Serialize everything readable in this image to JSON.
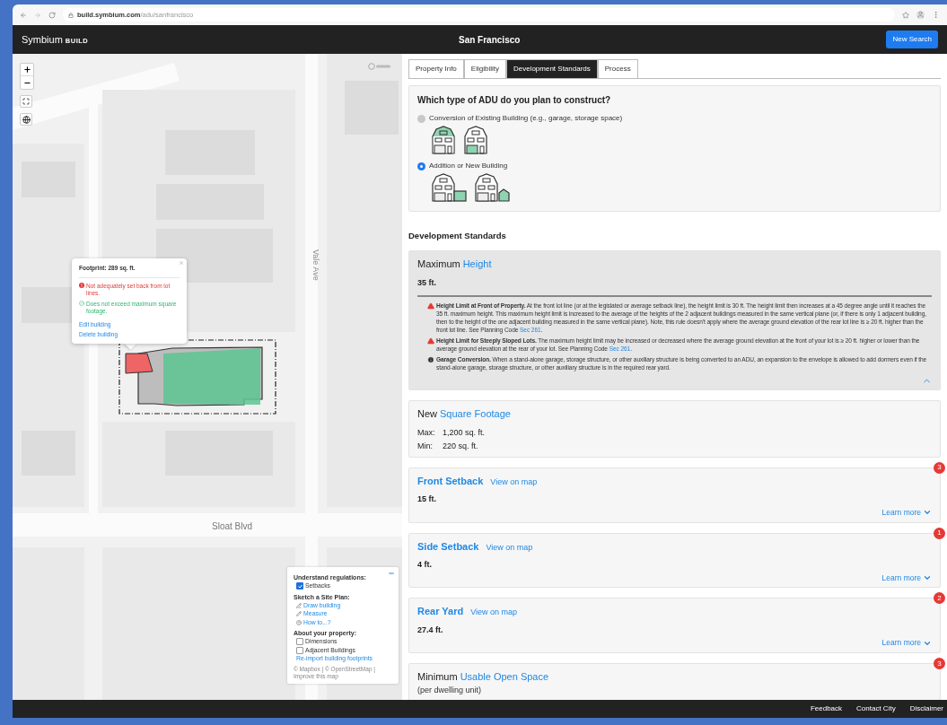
{
  "browser": {
    "host": "build.symbium.com",
    "path": "/adu/sanfrancisco"
  },
  "header": {
    "logo": "Symbium",
    "logo_suffix": "BUILD",
    "city": "San Francisco",
    "button": "New Search"
  },
  "map": {
    "streets": [
      {
        "name": "Vale Ave",
        "kind": "vertical"
      },
      {
        "name": "Sloat Blvd",
        "kind": "horizontal"
      }
    ],
    "popup": {
      "title": "Footprint: 289 sq. ft.",
      "checks": [
        {
          "kind": "fail",
          "text": "Not adequately set back from lot lines."
        },
        {
          "kind": "pass",
          "text": "Does not exceed maximum square footage."
        }
      ],
      "links": [
        "Edit building",
        "Delete building"
      ]
    },
    "legend": {
      "sections": [
        {
          "title": "Understand regulations:",
          "items": [
            {
              "kind": "checkbox",
              "label": "Setbacks",
              "checked": true
            }
          ]
        },
        {
          "title": "Sketch a Site Plan:",
          "items": [
            {
              "kind": "tool",
              "label": "Draw building"
            },
            {
              "kind": "tool",
              "label": "Measure"
            },
            {
              "kind": "help",
              "label": "How to...?"
            }
          ]
        },
        {
          "title": "About your property:",
          "items": [
            {
              "kind": "checkbox",
              "label": "Dimensions",
              "checked": false
            },
            {
              "kind": "checkbox",
              "label": "Adjacent Buildings",
              "checked": false
            },
            {
              "kind": "link",
              "label": "Re-import building footprints"
            }
          ]
        }
      ],
      "attribution": "© Mapbox | © OpenStreetMap | Improve this map"
    }
  },
  "tabs": [
    {
      "label": "Property Info",
      "selected": false
    },
    {
      "label": "Eligibility",
      "selected": false
    },
    {
      "label": "Development Standards",
      "selected": true
    },
    {
      "label": "Process",
      "selected": false
    }
  ],
  "adu": {
    "question": "Which type of ADU do you plan to construct?",
    "options": [
      {
        "label": "Conversion of Existing Building (e.g., garage, storage space)",
        "selected": false
      },
      {
        "label": "Addition or New Building",
        "selected": true
      }
    ]
  },
  "section_title": "Development Standards",
  "cards": [
    {
      "kind": "standard",
      "prefix": "Maximum",
      "title": "Height",
      "value": "35 ft.",
      "expanded": true,
      "notes": [
        {
          "kind": "warning",
          "title": "Height Limit at Front of Property.",
          "text": "At the front lot line (or at the legislated or average setback line), the height limit is 30 ft. The height limit then increases at a 45 degree angle until it reaches the 35 ft. maximum height. This maximum height limit is increased to the average of the heights of the 2 adjacent buildings measured in the same vertical plane (or, if there is only 1 adjacent building, then to the height of the one adjacent building measured in the same vertical plane). Note, this rule doesn't apply where the average ground elevation of the rear lot line is ≥ 20 ft. higher than the front lot line. See Planning Code",
          "link": "Sec 261",
          "tail": "."
        },
        {
          "kind": "warning",
          "title": "Height Limit for Steeply Sloped Lots.",
          "text": "The maximum height limit may be increased or decreased where the average ground elevation at the front of your lot is ≥ 20 ft. higher or lower than the average ground elevation at the rear of your lot. See Planning Code",
          "link": "Sec 261",
          "tail": "."
        },
        {
          "kind": "info",
          "title": "Garage Conversion.",
          "text": "When a stand-alone garage, storage structure, or other auxiliary structure is being converted to an ADU, an expansion to the envelope is allowed to add dormers even if the stand-alone garage, storage structure, or other auxiliary structure is in the required rear yard."
        }
      ]
    },
    {
      "kind": "standard",
      "prefix": "New",
      "title": "Square Footage",
      "rows": [
        {
          "label": "Max:",
          "value": "1,200 sq. ft."
        },
        {
          "label": "Min:",
          "value": "220 sq. ft."
        }
      ]
    },
    {
      "kind": "setback",
      "title": "Front Setback",
      "link": "View on map",
      "value": "15 ft.",
      "more": "Learn more",
      "expanded": false,
      "badge": "3"
    },
    {
      "kind": "setback",
      "title": "Side Setback",
      "link": "View on map",
      "value": "4 ft.",
      "more": "Learn more",
      "expanded": false,
      "badge": "1"
    },
    {
      "kind": "setback",
      "title": "Rear Yard",
      "link": "View on map",
      "value": "27.4 ft.",
      "more": "Learn more",
      "expanded": false,
      "badge": "2"
    },
    {
      "kind": "standard",
      "prefix": "Minimum",
      "title": "Usable Open Space",
      "subtitle": "(per dwelling unit)",
      "badge": "3"
    }
  ],
  "footer": [
    "Feedback",
    "Contact City",
    "Disclaimer"
  ]
}
